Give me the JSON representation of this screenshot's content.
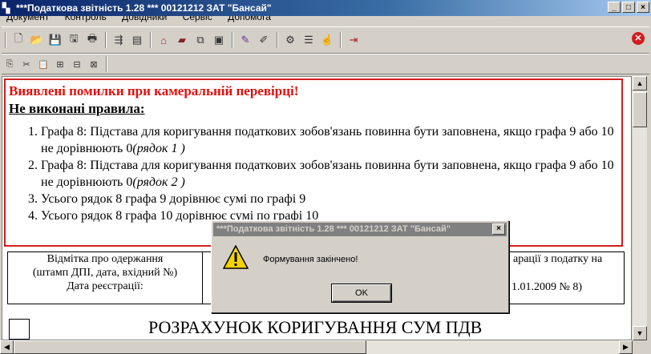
{
  "window": {
    "title": "***Податкова звітність 1.28 *** 00121212 ЗАТ \"Бансай\"",
    "minimize": "_",
    "maximize": "□",
    "close": "×"
  },
  "menu": [
    "Документ",
    "Контроль",
    "Довідники",
    "Сервіс",
    "Допомога"
  ],
  "errors": {
    "title": "Виявлені помилки при камеральній перевірці!",
    "subtitle": "Не виконані правила:",
    "items": [
      {
        "text": "Графа 8: Підстава для коригування податкових зобов'язань повинна бути заповнена, якщо графа 9 або 10 не дорівнюють 0",
        "ref": "(рядок 1 )"
      },
      {
        "text": "Графа 8: Підстава для коригування податкових зобов'язань повинна бути заповнена, якщо графа 9 або 10 не дорівнюють 0",
        "ref": "(рядок 2 )"
      },
      {
        "text": "Усього рядок 8 графа 9 дорівнює сумі по графі 9",
        "ref": ""
      },
      {
        "text": "Усього рядок 8 графа 10 дорівнює сумі по графі 10",
        "ref": ""
      }
    ]
  },
  "form": {
    "stamp_line1": "Відмітка про одержання",
    "stamp_line2": "(штамп ДПІ, дата, вхідний №)",
    "stamp_line3": "Дата реєстрації:",
    "decl_text": "арації з податку на",
    "decl_date": "1.01.2009 № 8)",
    "big_title": "РОЗРАХУНОК КОРИГУВАННЯ СУМ ПДВ"
  },
  "dialog": {
    "title": "***Податкова звітність 1.28 *** 00121212 ЗАТ \"Бансай\"",
    "message": "Формування закінчено!",
    "ok": "OK",
    "close": "×"
  },
  "colors": {
    "error_red": "#e01010",
    "title_blue": "#0a246a"
  }
}
